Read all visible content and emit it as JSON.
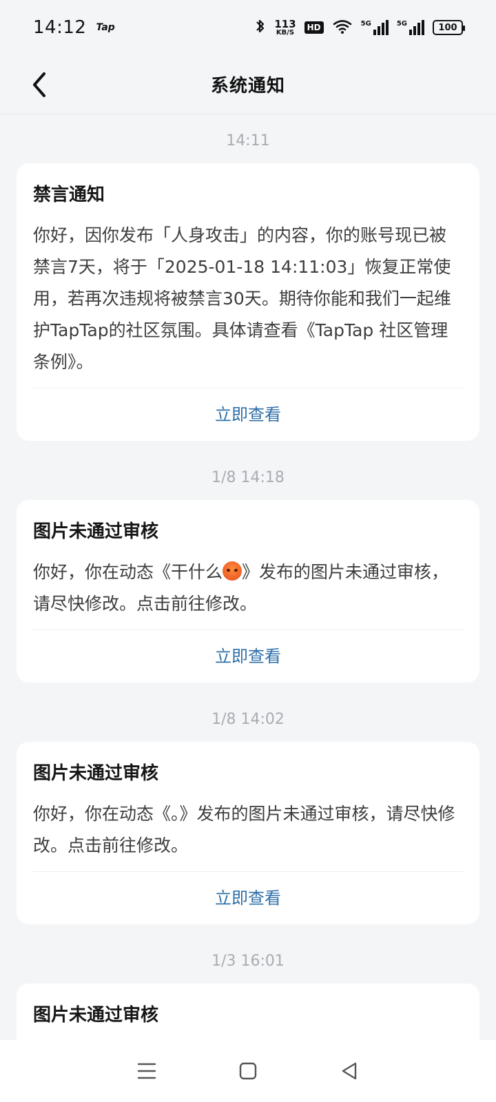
{
  "status_bar": {
    "time": "14:12",
    "app_label": "Tap",
    "net_speed": "113",
    "net_unit": "KB/S",
    "hd": "HD",
    "sim1": "5G",
    "sim2": "5G",
    "battery": "100"
  },
  "header": {
    "title": "系统通知",
    "back_icon": "chevron-left-icon"
  },
  "notifications": [
    {
      "timestamp": "14:11",
      "title": "禁言通知",
      "body": "你好，因你发布「人身攻击」的内容，你的账号现已被禁言7天，将于「2025-01-18 14:11:03」恢复正常使用，若再次违规将被禁言30天。期待你能和我们一起维护TapTap的社区氛围。具体请查看《TapTap 社区管理条例》。",
      "action": "立即查看"
    },
    {
      "timestamp": "1/8  14:18",
      "title": "图片未通过审核",
      "body_before": "你好，你在动态《干什么",
      "body_after": "》发布的图片未通过审核，请尽快修改。点击前往修改。",
      "emoji": "angry-face-icon",
      "action": "立即查看"
    },
    {
      "timestamp": "1/8  14:02",
      "title": "图片未通过审核",
      "body": "你好，你在动态《。》发布的图片未通过审核，请尽快修改。点击前往修改。",
      "action": "立即查看"
    },
    {
      "timestamp": "1/3  16:01",
      "title": "图片未通过审核"
    }
  ],
  "colors": {
    "background": "#f3f5f7",
    "card": "#ffffff",
    "link": "#2e6fa8",
    "timestamp": "#a8adb3"
  }
}
